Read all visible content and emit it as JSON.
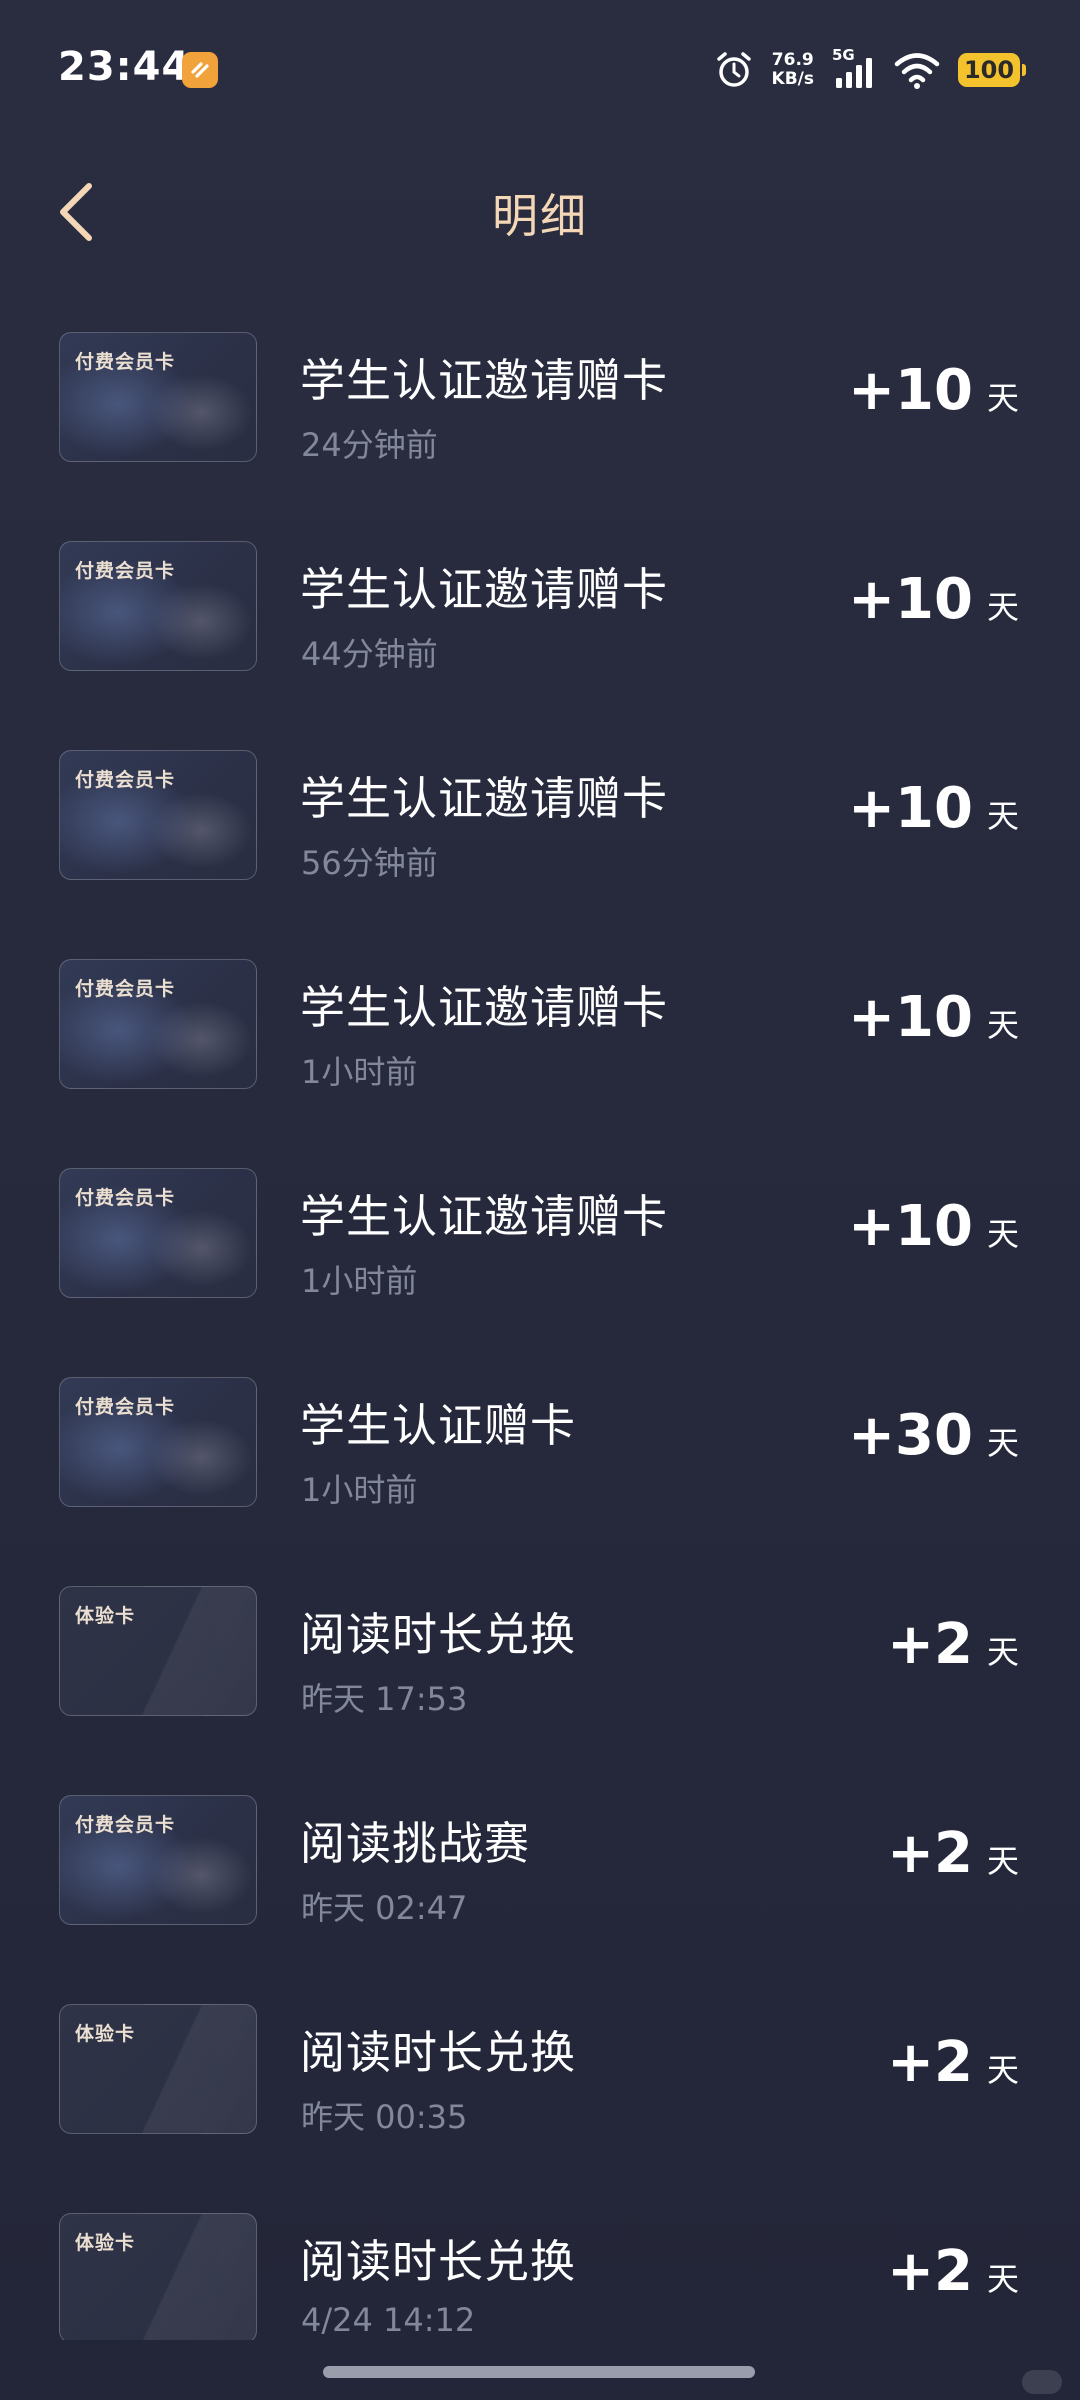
{
  "status_bar": {
    "time": "23:44",
    "net_speed_value": "76.9",
    "net_speed_unit": "KB/s",
    "signal_label": "5G",
    "battery": "100",
    "icons": [
      "app-badge-icon",
      "alarm-icon",
      "signal-icon",
      "wifi-icon",
      "battery-icon"
    ]
  },
  "header": {
    "title": "明细",
    "back_icon": "chevron-left-icon"
  },
  "records": [
    {
      "card_type": "paid",
      "card_label": "付费会员卡",
      "title": "学生认证邀请赠卡",
      "time": "24分钟前",
      "amount": "+10",
      "unit": "天"
    },
    {
      "card_type": "paid",
      "card_label": "付费会员卡",
      "title": "学生认证邀请赠卡",
      "time": "44分钟前",
      "amount": "+10",
      "unit": "天"
    },
    {
      "card_type": "paid",
      "card_label": "付费会员卡",
      "title": "学生认证邀请赠卡",
      "time": "56分钟前",
      "amount": "+10",
      "unit": "天"
    },
    {
      "card_type": "paid",
      "card_label": "付费会员卡",
      "title": "学生认证邀请赠卡",
      "time": "1小时前",
      "amount": "+10",
      "unit": "天"
    },
    {
      "card_type": "paid",
      "card_label": "付费会员卡",
      "title": "学生认证邀请赠卡",
      "time": "1小时前",
      "amount": "+10",
      "unit": "天"
    },
    {
      "card_type": "paid",
      "card_label": "付费会员卡",
      "title": "学生认证赠卡",
      "time": "1小时前",
      "amount": "+30",
      "unit": "天"
    },
    {
      "card_type": "trial",
      "card_label": "体验卡",
      "title": "阅读时长兑换",
      "time": "昨天  17:53",
      "amount": "+2",
      "unit": "天"
    },
    {
      "card_type": "paid",
      "card_label": "付费会员卡",
      "title": "阅读挑战赛",
      "time": "昨天  02:47",
      "amount": "+2",
      "unit": "天"
    },
    {
      "card_type": "trial",
      "card_label": "体验卡",
      "title": "阅读时长兑换",
      "time": "昨天  00:35",
      "amount": "+2",
      "unit": "天"
    },
    {
      "card_type": "trial",
      "card_label": "体验卡",
      "title": "阅读时长兑换",
      "time": "4/24 14:12",
      "amount": "+2",
      "unit": "天"
    }
  ],
  "colors": {
    "background": "#272a3d",
    "title_accent": "#f4d7b6",
    "secondary_text": "#82879a",
    "battery": "#f3c22c",
    "app_badge": "#f1a23b"
  }
}
